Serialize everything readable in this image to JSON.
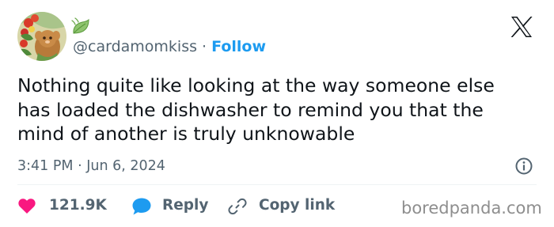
{
  "account": {
    "handle": "@cardamomkiss",
    "separator": "·",
    "follow_label": "Follow"
  },
  "tweet": {
    "lines": [
      "Nothing quite like looking at the way someone else",
      "has loaded the dishwasher to remind you that the",
      "mind of another is truly unknowable"
    ],
    "timestamp": "3:41 PM · Jun 6, 2024"
  },
  "actions": {
    "likes": "121.9K",
    "reply_label": "Reply",
    "copy_link_label": "Copy link"
  },
  "watermark": "boredpanda.com",
  "icons": {
    "badge": "leaf-icon",
    "platform": "x-logo-icon",
    "info": "info-icon",
    "like": "heart-icon",
    "reply": "speech-bubble-icon",
    "copy": "link-icon"
  },
  "colors": {
    "text": "#0f1419",
    "secondary": "#536471",
    "accent": "#1d9bf0",
    "like": "#f91880",
    "watermark": "#8e8e8e"
  }
}
